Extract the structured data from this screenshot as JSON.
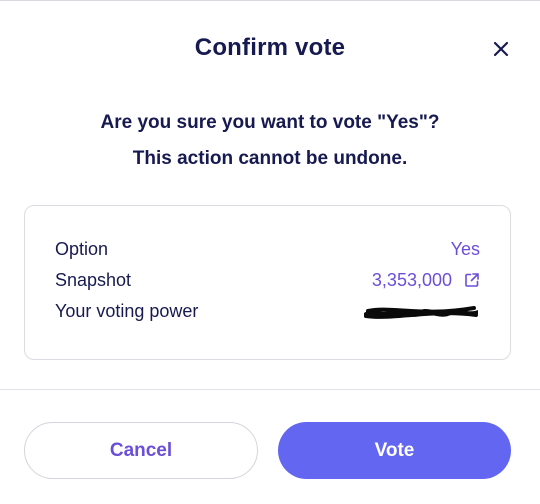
{
  "dialog": {
    "title": "Confirm vote",
    "close_icon": "close-icon",
    "prompt_line1": "Are you sure you want to vote \"Yes\"?",
    "prompt_line2": "This action cannot be undone."
  },
  "details": {
    "option": {
      "label": "Option",
      "value": "Yes"
    },
    "snapshot": {
      "label": "Snapshot",
      "value": "3,353,000",
      "icon": "external-link-icon"
    },
    "voting_power": {
      "label": "Your voting power",
      "value_redacted": true
    }
  },
  "actions": {
    "cancel_label": "Cancel",
    "vote_label": "Vote"
  },
  "colors": {
    "heading": "#161a50",
    "accent": "#6b4fd8",
    "primary_button": "#6366f1"
  }
}
